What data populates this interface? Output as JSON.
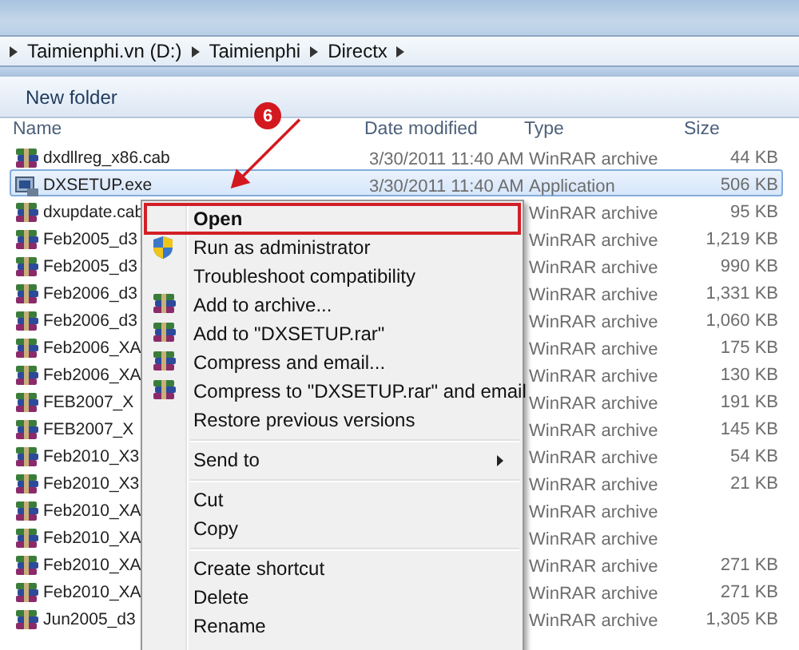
{
  "address_bar": {
    "segments": [
      "Taimienphi.vn (D:)",
      "Taimienphi",
      "Directx"
    ]
  },
  "toolbar": {
    "buttons": [
      "New folder"
    ]
  },
  "table": {
    "columns": [
      "Name",
      "Date modified",
      "Type",
      "Size"
    ],
    "rows": [
      {
        "kind": "archive",
        "name": "dxdllreg_x86.cab",
        "date": "3/30/2011 11:40 AM",
        "type": "WinRAR archive",
        "size": "44 KB",
        "selected": false
      },
      {
        "kind": "application",
        "name": "DXSETUP.exe",
        "date": "3/30/2011 11:40 AM",
        "type": "Application",
        "size": "506 KB",
        "selected": true
      },
      {
        "kind": "archive",
        "name": "dxupdate.cab",
        "type": "WinRAR archive",
        "size": "95 KB",
        "selected": false
      },
      {
        "kind": "archive",
        "name": "Feb2005_d3",
        "type": "WinRAR archive",
        "size": "1,219 KB",
        "selected": false
      },
      {
        "kind": "archive",
        "name": "Feb2005_d3",
        "type": "WinRAR archive",
        "size": "990 KB",
        "selected": false
      },
      {
        "kind": "archive",
        "name": "Feb2006_d3",
        "type": "WinRAR archive",
        "size": "1,331 KB",
        "selected": false
      },
      {
        "kind": "archive",
        "name": "Feb2006_d3",
        "type": "WinRAR archive",
        "size": "1,060 KB",
        "selected": false
      },
      {
        "kind": "archive",
        "name": "Feb2006_XA",
        "type": "WinRAR archive",
        "size": "175 KB",
        "selected": false
      },
      {
        "kind": "archive",
        "name": "Feb2006_XA",
        "type": "WinRAR archive",
        "size": "130 KB",
        "selected": false
      },
      {
        "kind": "archive",
        "name": "FEB2007_X",
        "type": "WinRAR archive",
        "size": "191 KB",
        "selected": false
      },
      {
        "kind": "archive",
        "name": "FEB2007_X",
        "type": "WinRAR archive",
        "size": "145 KB",
        "selected": false
      },
      {
        "kind": "archive",
        "name": "Feb2010_X3",
        "type": "WinRAR archive",
        "size": "54 KB",
        "selected": false
      },
      {
        "kind": "archive",
        "name": "Feb2010_X3",
        "type": "WinRAR archive",
        "size": "21 KB",
        "selected": false
      },
      {
        "kind": "archive",
        "name": "Feb2010_XA",
        "type": "WinRAR archive",
        "selected": false
      },
      {
        "kind": "archive",
        "name": "Feb2010_XA",
        "type": "WinRAR archive",
        "selected": false
      },
      {
        "kind": "archive",
        "name": "Feb2010_XA",
        "type": "WinRAR archive",
        "size": "271 KB",
        "selected": false
      },
      {
        "kind": "archive",
        "name": "Feb2010_XA",
        "type": "WinRAR archive",
        "size": "271 KB",
        "selected": false
      },
      {
        "kind": "archive",
        "name": "Jun2005_d3",
        "type": "WinRAR archive",
        "size": "1,305 KB",
        "selected": false
      }
    ]
  },
  "context_menu": {
    "items": [
      {
        "kind": "item",
        "label": "Open",
        "bold": true,
        "highlighted": true
      },
      {
        "kind": "shield_item",
        "label": "Run as administrator",
        "bold": false,
        "highlighted": false
      },
      {
        "kind": "item",
        "label": "Troubleshoot compatibility",
        "bold": false,
        "highlighted": false
      },
      {
        "kind": "archive_item",
        "label": "Add to archive...",
        "bold": false,
        "highlighted": false
      },
      {
        "kind": "archive_item",
        "label": "Add to \"DXSETUP.rar\"",
        "bold": false,
        "highlighted": false
      },
      {
        "kind": "archive_item",
        "label": "Compress and email...",
        "bold": false,
        "highlighted": false
      },
      {
        "kind": "archive_item",
        "label": "Compress to \"DXSETUP.rar\" and email",
        "bold": false,
        "highlighted": false
      },
      {
        "kind": "item",
        "label": "Restore previous versions",
        "bold": false,
        "highlighted": false
      },
      {
        "kind": "separator"
      },
      {
        "kind": "submenu",
        "label": "Send to",
        "bold": false,
        "highlighted": false
      },
      {
        "kind": "separator"
      },
      {
        "kind": "item",
        "label": "Cut",
        "bold": false,
        "highlighted": false
      },
      {
        "kind": "item",
        "label": "Copy",
        "bold": false,
        "highlighted": false
      },
      {
        "kind": "separator"
      },
      {
        "kind": "item",
        "label": "Create shortcut",
        "bold": false,
        "highlighted": false
      },
      {
        "kind": "item",
        "label": "Delete",
        "bold": false,
        "highlighted": false
      },
      {
        "kind": "item",
        "label": "Rename",
        "bold": false,
        "highlighted": false
      }
    ]
  },
  "annotation": {
    "step": "6"
  }
}
